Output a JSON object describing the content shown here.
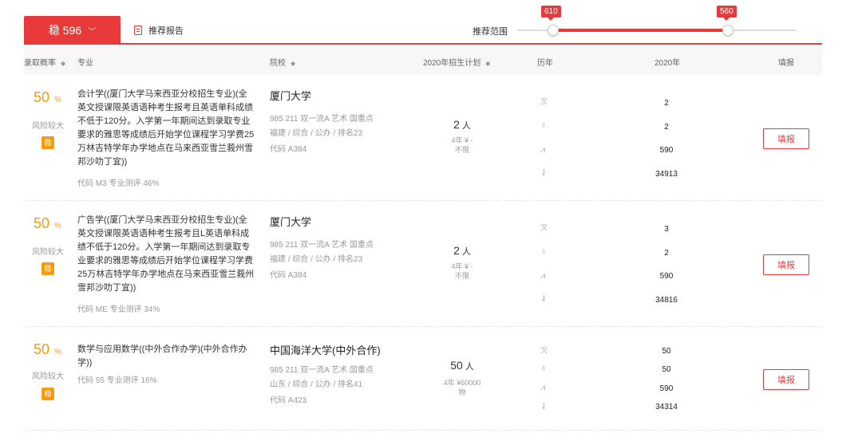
{
  "top": {
    "tab_label": "稳 596",
    "tab_chevron": "﹀",
    "report_label": "推荐报告",
    "range_label": "推荐范围",
    "range_low": "610",
    "range_high": "560"
  },
  "table": {
    "headers": {
      "prob": "录取概率",
      "major": "专业",
      "school": "院校",
      "plan": "2020年招生计划",
      "history": "历年",
      "year": "2020年",
      "fill": "填报"
    },
    "sort_glyph": "◆"
  },
  "rows": [
    {
      "prob": "50",
      "prob_unit": "%",
      "risk": "风险较大",
      "badge": "稳",
      "major_lines": [
        "会计学((厦门大学马来西亚分校招生专业)(全",
        "英文授课限英语语种考生报考且英语单科成绩",
        "不低于120分。入学第一年期间达到录取专业",
        "要求的雅思等成绩后开始学位课程学习学费25",
        "万林吉特学年办学地点在马来西亚雪兰莪州雪",
        "邦沙叻丁宜))"
      ],
      "major_meta": "代码 M3   专业测评 46%",
      "school": "厦门大学",
      "school_tags": "985 211 双一流A 艺术 国重点",
      "school_loc": "福建 / 综合 / 公办 / 排名23",
      "school_code": "代码 A384",
      "plan_num": "2",
      "plan_unit": "人",
      "plan_sub1": "4年 ¥ -",
      "plan_sub2": "不限",
      "year_vals": [
        "2",
        "2",
        "590",
        "34913"
      ],
      "fill": "填报"
    },
    {
      "prob": "50",
      "prob_unit": "%",
      "risk": "风险较大",
      "badge": "稳",
      "major_lines": [
        "广告学((厦门大学马来西亚分校招生专业)(全",
        "英文授课限英语语种考生报考且L英语单科成",
        "绩不低于120分。入学第一年期间达到录取专",
        "业要求的雅思等成绩后开始学位课程学习学费",
        "25万林吉特学年办学地点在马来西亚雪兰莪州",
        "雪邦沙叻丁宜))"
      ],
      "major_meta": "代码 ME   专业测评 34%",
      "school": "厦门大学",
      "school_tags": "985 211 双一流A 艺术 国重点",
      "school_loc": "福建 / 综合 / 公办 / 排名23",
      "school_code": "代码 A384",
      "plan_num": "2",
      "plan_unit": "人",
      "plan_sub1": "4年 ¥ -",
      "plan_sub2": "不限",
      "year_vals": [
        "3",
        "2",
        "590",
        "34816"
      ],
      "fill": "填报"
    },
    {
      "prob": "50",
      "prob_unit": "%",
      "risk": "风险较大",
      "badge": "稳",
      "major_lines": [
        "数学与应用数学((中外合作办学)(中外合作办",
        "学))"
      ],
      "major_meta": "代码 55   专业测评 16%",
      "school": "中国海洋大学(中外合作)",
      "school_tags": "985 211 双一流A 艺术 国重点",
      "school_loc": "山东 / 综合 / 公办 / 排名41",
      "school_code": "代码 A423",
      "plan_num": "50",
      "plan_unit": "人",
      "plan_sub1": "4年 ¥60000",
      "plan_sub2": "物",
      "year_vals": [
        "50",
        "50",
        "590",
        "34314"
      ],
      "fill": "填报"
    }
  ]
}
